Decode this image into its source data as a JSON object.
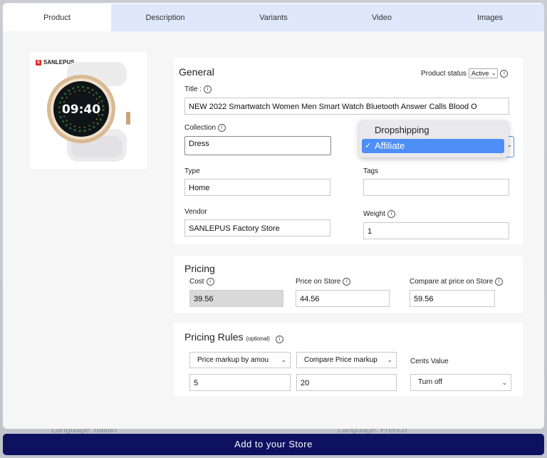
{
  "tabs": [
    {
      "label": "Product",
      "active": true
    },
    {
      "label": "Description",
      "active": false
    },
    {
      "label": "Variants",
      "active": false
    },
    {
      "label": "Video",
      "active": false
    },
    {
      "label": "Images",
      "active": false
    }
  ],
  "product_image": {
    "brand": "SANLEPUS",
    "watch_time": "09:40"
  },
  "general": {
    "title": "General",
    "status_label": "Product status",
    "status_value": "Active",
    "title_label": "Title :",
    "title_value": "NEW 2022 Smartwatch Women Men Smart Watch Bluetooth Answer Calls Blood O",
    "collection_label": "Collection",
    "collection_value": "Dress",
    "type_label": "Type",
    "type_value": "Home",
    "tags_label": "Tags",
    "tags_value": "",
    "vendor_label": "Vendor",
    "vendor_value": "SANLEPUS Factory Store",
    "weight_label": "Weight",
    "weight_value": "1",
    "dropdown_options": [
      "Dropshipping",
      "Affiliate"
    ],
    "dropdown_selected": "Affiliate",
    "check_mark": "✓"
  },
  "pricing": {
    "title": "Pricing",
    "cost_label": "Cost",
    "cost_value": "39.56",
    "price_label": "Price on Store",
    "price_value": "44.56",
    "compare_label": "Compare at price on Store",
    "compare_value": "59.56"
  },
  "pricing_rules": {
    "title": "Pricing Rules",
    "optional": "(optional)",
    "markup_select": "Price markup by amou",
    "compare_select": "Compare Price markup",
    "cents_label": "Cents Value",
    "markup_value": "5",
    "compare_value": "20",
    "cents_select": "Turn off"
  },
  "background": {
    "lang_left": "Language: Italian",
    "lang_right": "Language: French"
  },
  "footer": {
    "add_button": "Add to your Store"
  }
}
